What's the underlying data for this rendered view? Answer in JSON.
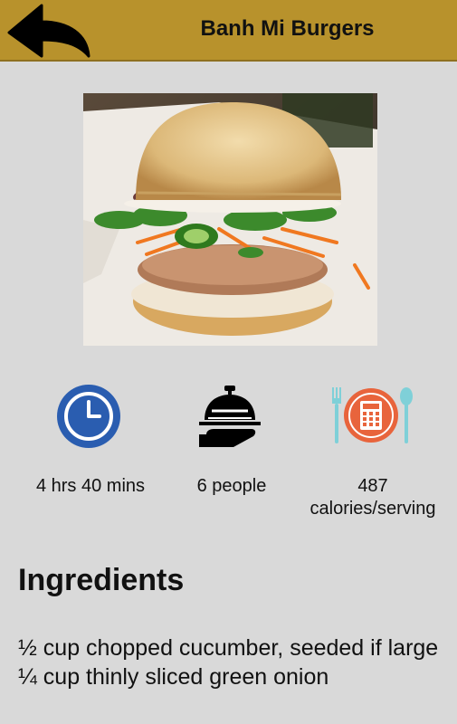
{
  "header": {
    "title": "Banh Mi Burgers",
    "back_icon": "back-arrow-icon"
  },
  "photo": {
    "alt": "Banh Mi Burger photo"
  },
  "stats": [
    {
      "icon": "clock-icon",
      "label": "4 hrs 40 mins"
    },
    {
      "icon": "serving-cloche-icon",
      "label": "6 people"
    },
    {
      "icon": "calculator-plate-icon",
      "label_line1": "487",
      "label_line2": "calories/serving"
    }
  ],
  "ingredients": {
    "title": "Ingredients",
    "items": [
      "½ cup chopped cucumber, seeded if large",
      "¼ cup thinly sliced green onion"
    ]
  },
  "colors": {
    "header_bg": "#b8922c",
    "page_bg": "#d9d9d9",
    "clock_blue": "#2a5db0",
    "calc_orange": "#e8643c",
    "utensil_teal": "#7fd0d8"
  }
}
